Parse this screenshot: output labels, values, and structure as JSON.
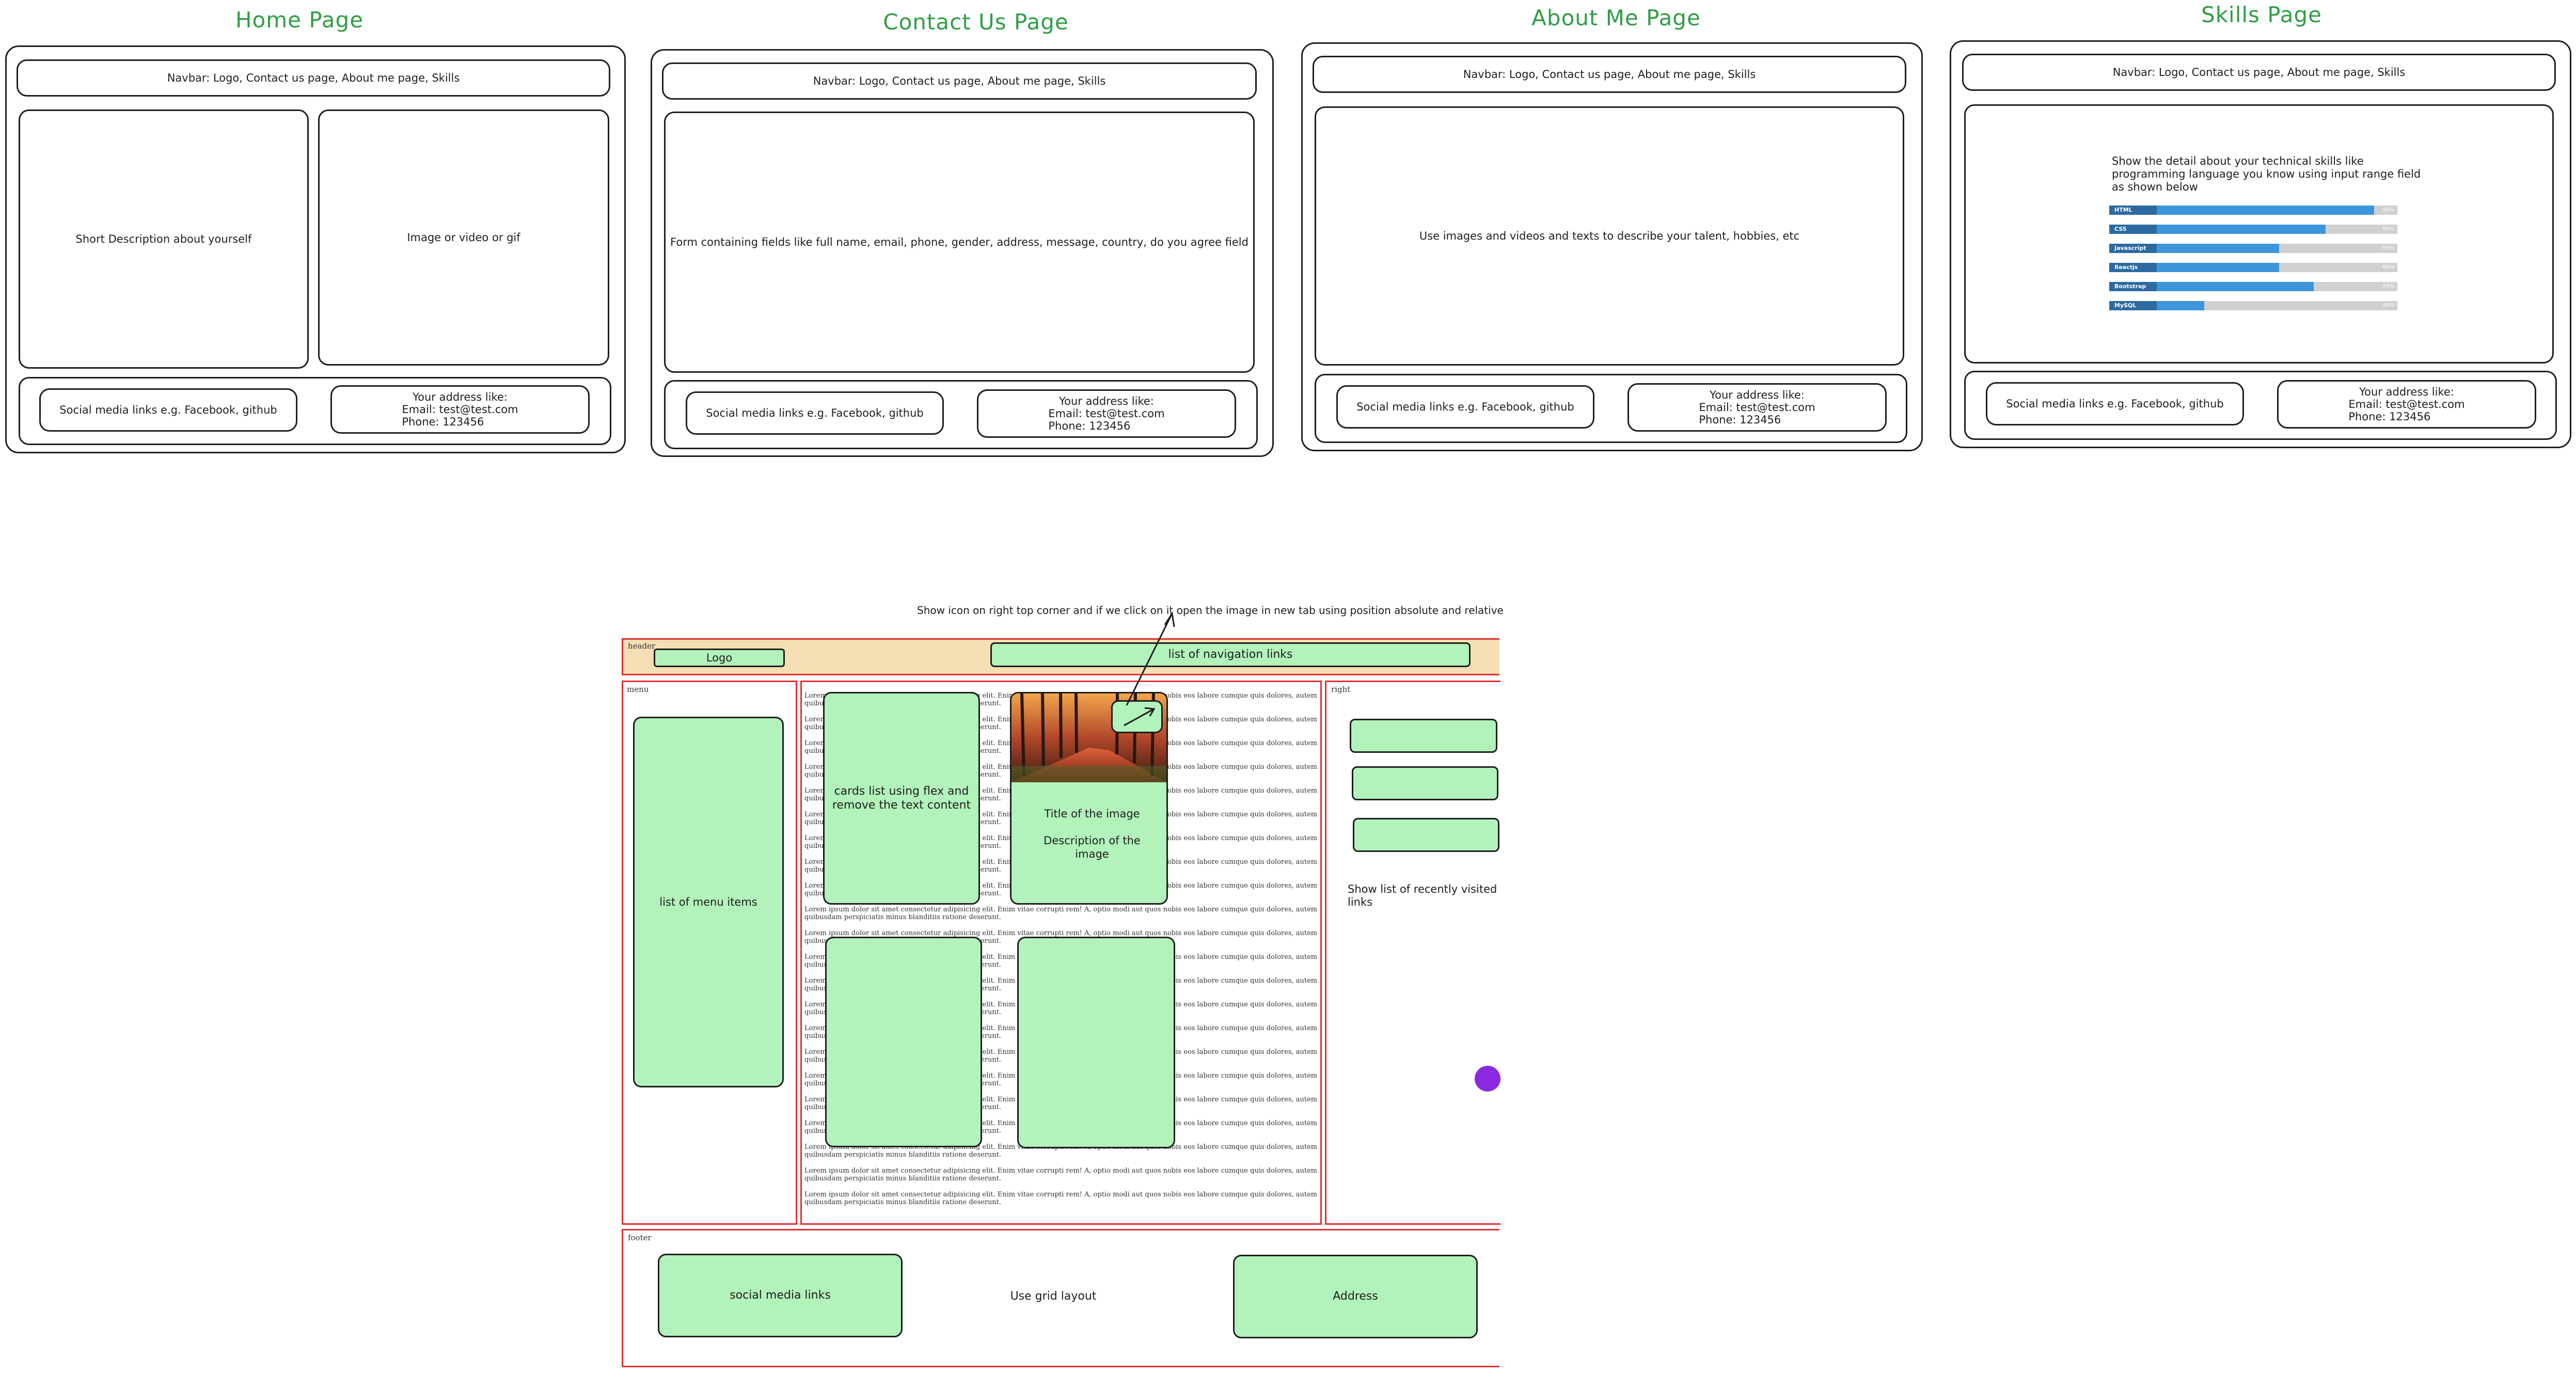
{
  "pages": {
    "home": {
      "title": "Home Page",
      "navbar": "Navbar: Logo, Contact us page, About me page, Skills",
      "left_box": "Short Description about yourself",
      "right_box": "Image or video or gif",
      "social": "Social media links e.g. Facebook, github",
      "address": [
        "Your address like:",
        "Email: test@test.com",
        "Phone: 123456"
      ]
    },
    "contact": {
      "title": "Contact Us Page",
      "navbar": "Navbar: Logo, Contact us page, About me page, Skills",
      "main": "Form containing fields like full name, email, phone, gender, address, message, country, do you agree field",
      "social": "Social media links e.g. Facebook, github",
      "address": [
        "Your address like:",
        "Email: test@test.com",
        "Phone: 123456"
      ]
    },
    "about": {
      "title": "About Me Page",
      "navbar": "Navbar: Logo, Contact us page, About me page, Skills",
      "main": "Use images and videos and texts to describe your talent, hobbies, etc",
      "social": "Social media links e.g. Facebook, github",
      "address": [
        "Your address like:",
        "Email: test@test.com",
        "Phone: 123456"
      ]
    },
    "skills": {
      "title": "Skills Page",
      "navbar": "Navbar: Logo, Contact us page, About me page, Skills",
      "main": "Show the detail about your technical skills like programming language you know using input range field as shown below",
      "social": "Social media links e.g. Facebook, github",
      "address": [
        "Your address like:",
        "Email: test@test.com",
        "Phone: 123456"
      ],
      "skills": [
        {
          "name": "HTML",
          "level": 0.92,
          "pct": "90%"
        },
        {
          "name": "CSS",
          "level": 0.75,
          "pct": "80%"
        },
        {
          "name": "Javascript",
          "level": 0.59,
          "pct": "65%"
        },
        {
          "name": "Reactjs",
          "level": 0.59,
          "pct": "60%"
        },
        {
          "name": "Bootstrap",
          "level": 0.71,
          "pct": "55%"
        },
        {
          "name": "MySQL",
          "level": 0.33,
          "pct": "40%"
        }
      ]
    }
  },
  "wireframe": {
    "annotation": "Show icon on right top corner and if we click on it open the image in new tab using position absolute and relative",
    "header_label": "header",
    "logo": "Logo",
    "nav": "list of navigation links",
    "menu_label": "menu",
    "menu_items": "list of menu items",
    "cards_note": "cards list using flex and remove the text content",
    "card_title": "Title of the image",
    "card_desc": "Description of the image",
    "right_label": "right",
    "recent": "Show list of recently visited links",
    "footer_label": "footer",
    "footer_social": "social media links",
    "footer_grid": "Use grid layout",
    "footer_address": "Address",
    "lorem": "Lorem ipsum dolor sit amet consectetur adipisicing elit. Enim vitae corrupti rem! A, optio modi aut quos nobis eos labore cumque quis dolores, autem quibusdam perspiciatis minus blanditiis ratione deserunt.",
    "lorem_count": 22
  },
  "colors": {
    "title": "#2f9e44",
    "green_fill": "#b2f2bb",
    "red_border": "#e03131",
    "header_fill": "#f5deb3",
    "fab": "#8a2be2"
  }
}
